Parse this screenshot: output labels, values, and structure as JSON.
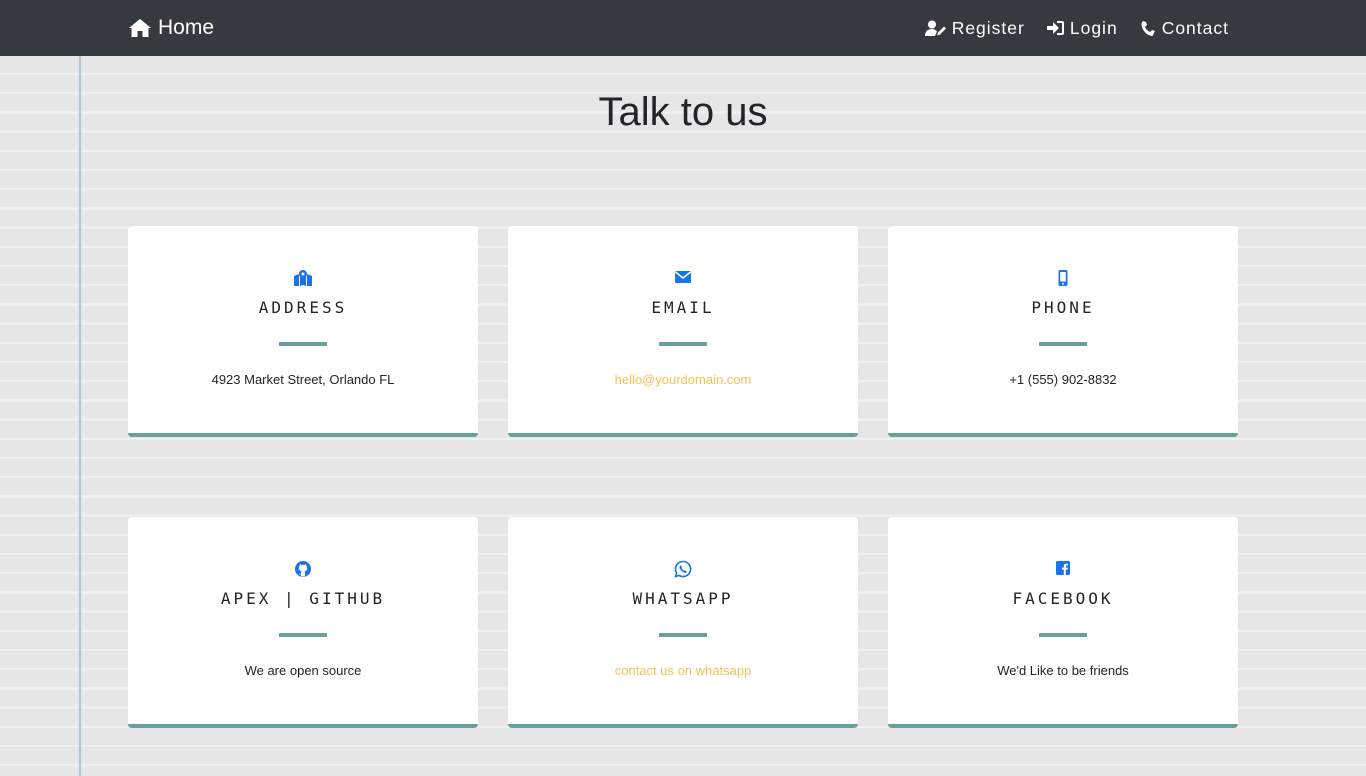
{
  "nav": {
    "brand": "Home",
    "links": [
      {
        "label": "Register",
        "icon": "user-edit-icon"
      },
      {
        "label": "Login",
        "icon": "sign-in-icon"
      },
      {
        "label": "Contact",
        "icon": "phone-icon"
      }
    ]
  },
  "page": {
    "title": "Talk to us"
  },
  "cards": [
    {
      "title": "ADDRESS",
      "text": "4923 Market Street, Orlando FL",
      "icon": "map-marked-icon"
    },
    {
      "title": "EMAIL",
      "text": "hello@yourdomain.com",
      "icon": "envelope-icon"
    },
    {
      "title": "PHONE",
      "text": "+1 (555) 902-8832",
      "icon": "mobile-icon"
    },
    {
      "title": "APEX | GITHUB",
      "text": "We are open source",
      "icon": "github-icon"
    },
    {
      "title": "WHATSAPP",
      "text": "contact us on whatsapp",
      "icon": "whatsapp-icon"
    },
    {
      "title": "FACEBOOK",
      "text": "We'd Like to be friends",
      "icon": "facebook-icon"
    }
  ],
  "colors": {
    "navbar": "#343a40",
    "accent": "#6a9f9a",
    "icon": "#1a73e8",
    "link": "#f6c157"
  }
}
